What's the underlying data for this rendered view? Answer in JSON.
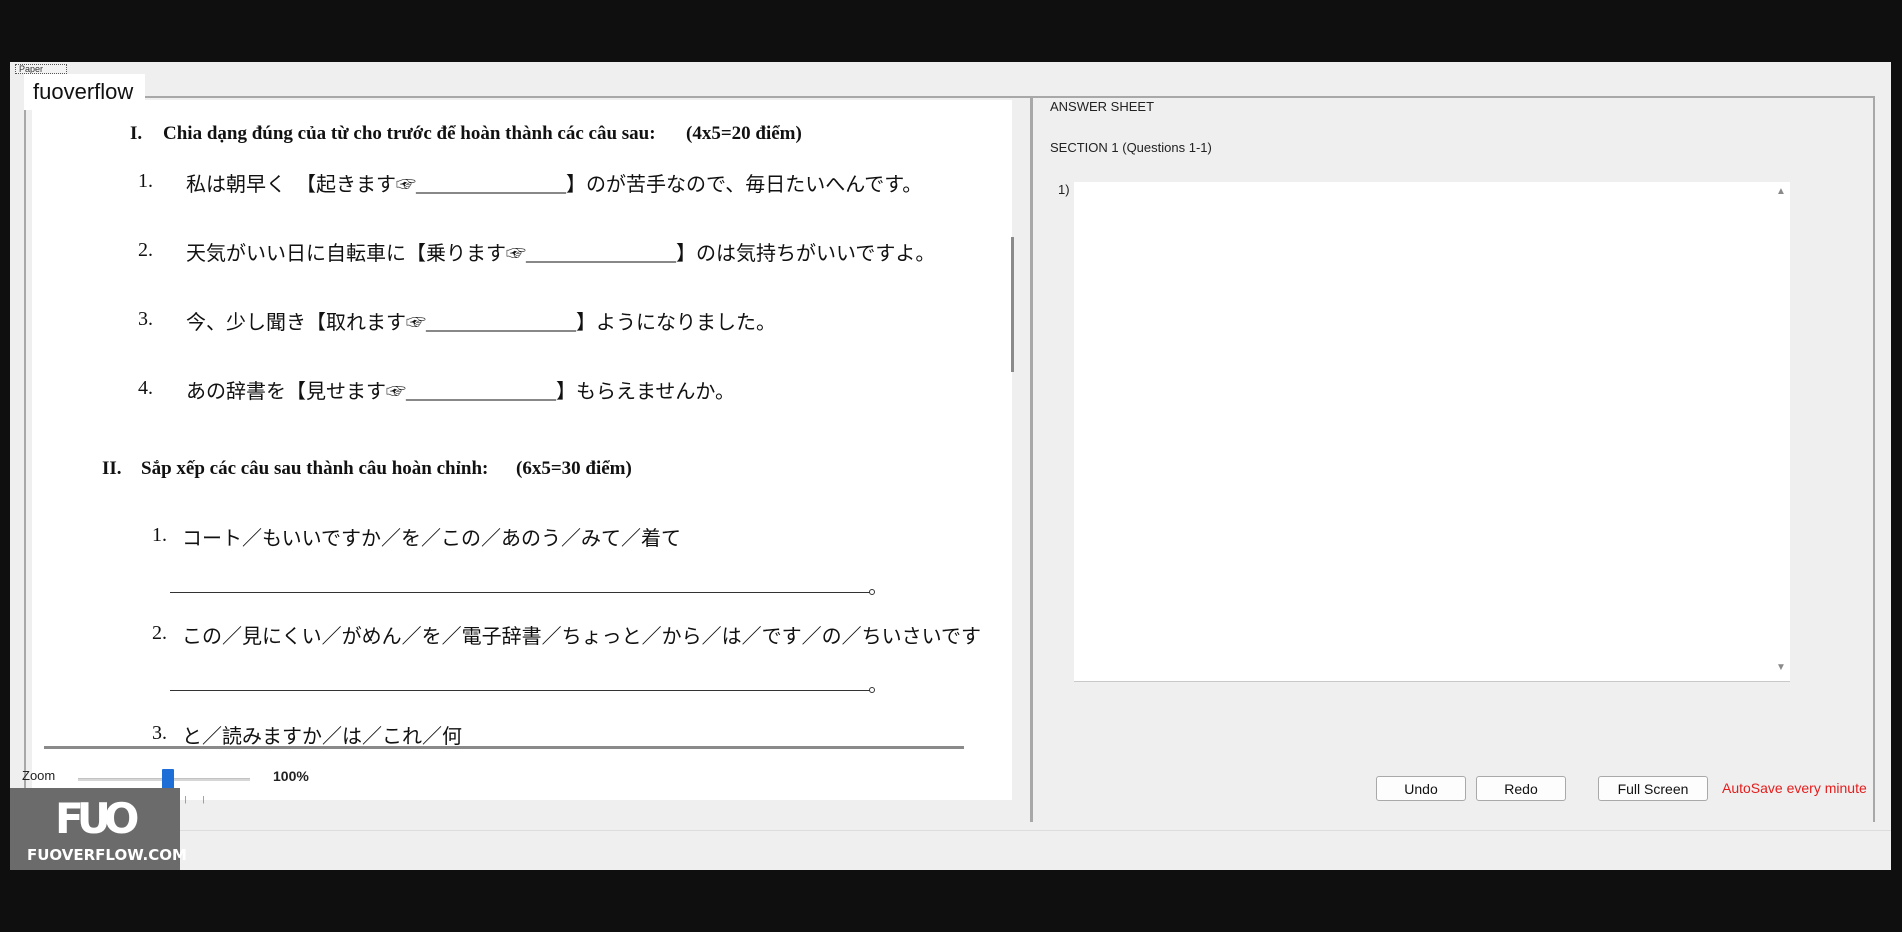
{
  "paper_tab": {
    "label": "Paper"
  },
  "watermark_label": "fuoverflow",
  "paper": {
    "section1": {
      "numeral": "I.",
      "title": "Chia dạng đúng của từ cho trước để hoàn thành các câu sau:",
      "score": "(4x5=20 điểm)",
      "items": [
        {
          "num": "1.",
          "text": "私は朝早く　【起きます☞_______________】のが苦手なので、毎日たいへんです。"
        },
        {
          "num": "2.",
          "text": "天気がいい日に自転車に【乗ります☞_______________】のは気持ちがいいですよ。"
        },
        {
          "num": "3.",
          "text": "今、少し聞き【取れます☞_______________】ようになりました。"
        },
        {
          "num": "4.",
          "text": "あの辞書を【見せます☞_______________】もらえませんか。"
        }
      ]
    },
    "section2": {
      "numeral": "II.",
      "title": "Sắp xếp các câu sau thành câu hoàn chỉnh:",
      "score": "(6x5=30 điểm)",
      "items": [
        {
          "num": "1.",
          "text": "コート／もいいですか／を／この／あのう／みて／着て"
        },
        {
          "num": "2.",
          "text": "この／見にくい／がめん／を／電子辞書／ちょっと／から／は／です／の／ちいさいです"
        },
        {
          "num": "3.",
          "text": "と／読みますか／は／これ／何"
        }
      ]
    }
  },
  "answer_sheet": {
    "title": "ANSWER SHEET",
    "section": "SECTION 1 (Questions 1-1)",
    "question_label": "1)",
    "answer_value": ""
  },
  "zoom": {
    "label": "Zoom",
    "value": "100%",
    "level_percent": 100
  },
  "buttons": {
    "undo": "Undo",
    "redo": "Redo",
    "fullscreen": "Full Screen"
  },
  "autosave": "AutoSave every minute",
  "logo": {
    "mark": "FUO",
    "text": "FUOVERFLOW.COM"
  },
  "colors": {
    "autosave": "#e41d1d",
    "slider_thumb": "#1e6ed8",
    "background": "#efefef"
  }
}
